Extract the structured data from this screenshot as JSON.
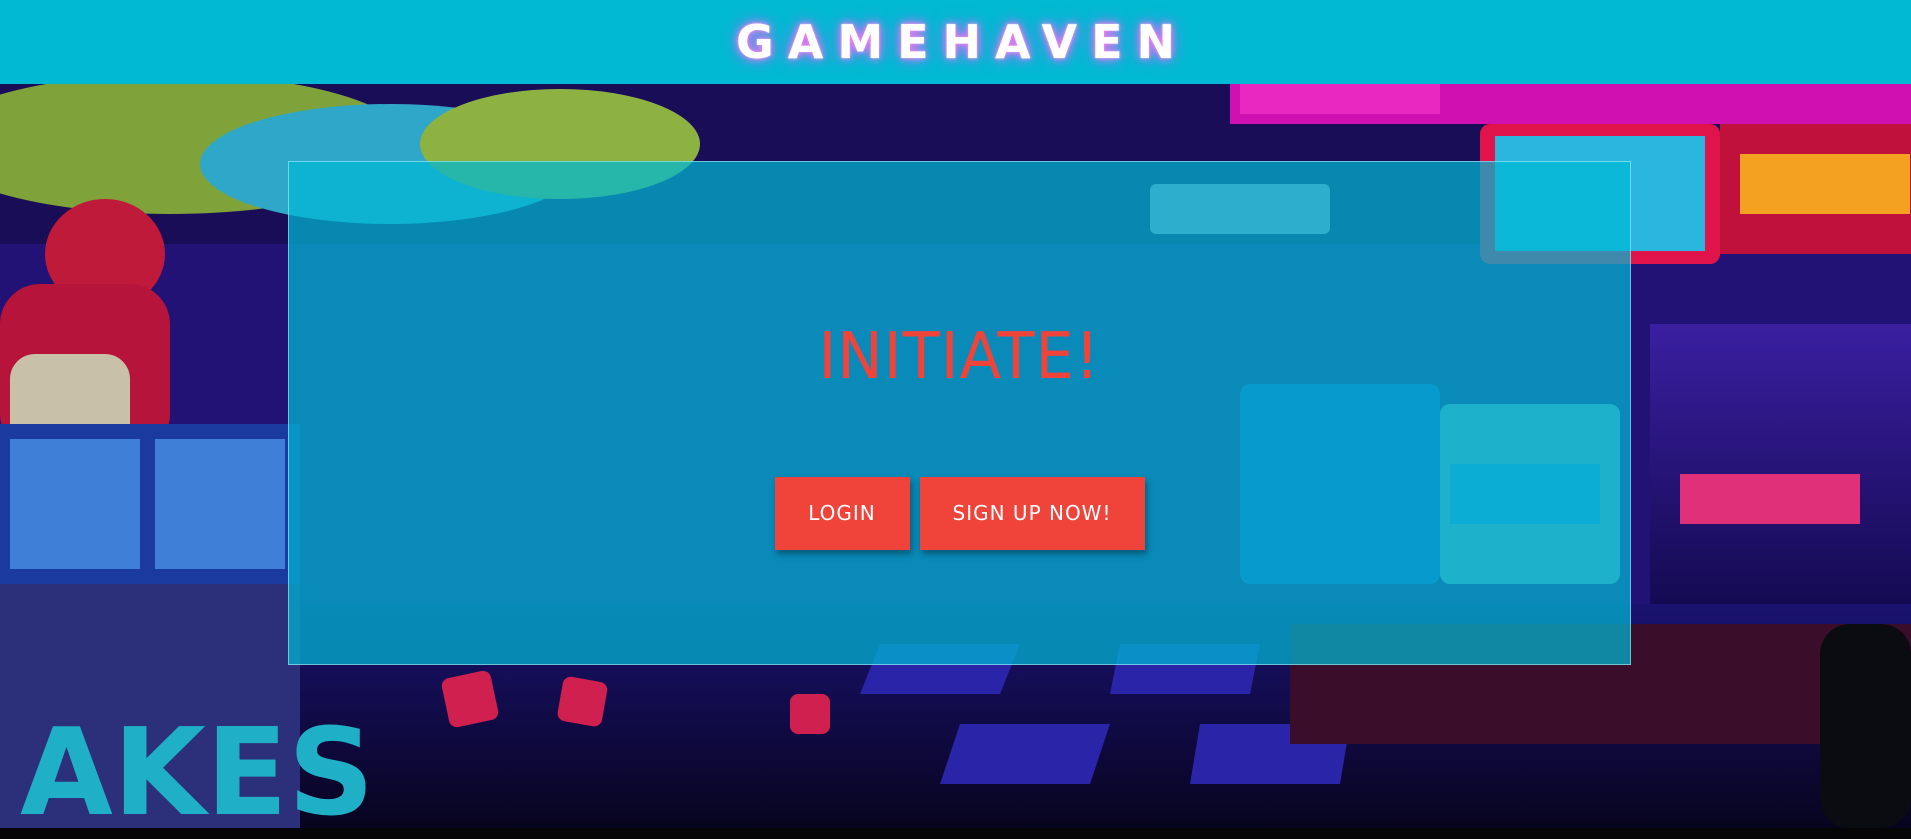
{
  "header": {
    "logo_text": "GAMEHAVEN"
  },
  "hero": {
    "background_image": "arcade-scene",
    "headline": "INITIATE!",
    "login_label": "LOGIN",
    "signup_label": "SIGN UP NOW!"
  },
  "colors": {
    "header_bg": "#00b9d3",
    "overlay_bg": "#00b9d3",
    "accent": "#f0433a",
    "button_text": "#ffffff",
    "logo_glow": "#ff7cf0"
  }
}
